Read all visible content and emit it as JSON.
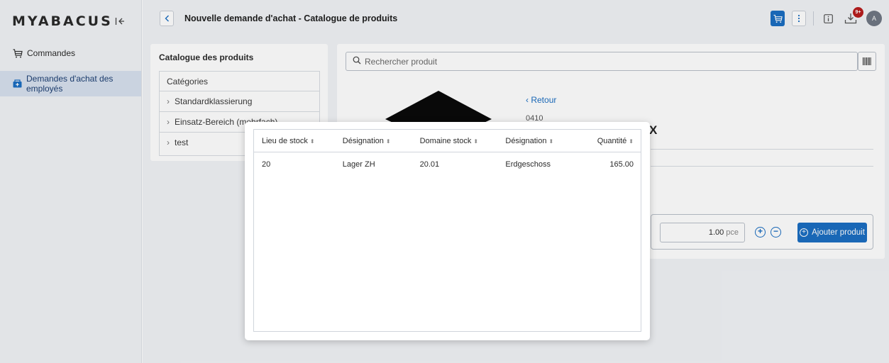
{
  "app": {
    "logo_text": "MYABACUS",
    "accent_color": "#1b6ec2"
  },
  "sidebar": {
    "collapse_icon": "collapse-left-icon",
    "items": [
      {
        "label": "Commandes",
        "icon": "cart-icon",
        "active": false
      },
      {
        "label": "Demandes d'achat des employés",
        "icon": "box-icon",
        "active": true
      }
    ]
  },
  "header": {
    "title": "Nouvelle demande d'achat - Catalogue de produits",
    "badge_count": "9+",
    "avatar_initial": "A"
  },
  "catalogue": {
    "title": "Catalogue des produits",
    "categories_label": "Catégories",
    "items": [
      {
        "label": "Standardklassierung"
      },
      {
        "label": "Einsatz-Bereich (mehrfach)"
      },
      {
        "label": "test"
      }
    ]
  },
  "product": {
    "search_placeholder": "Rechercher produit",
    "back_label": "Retour",
    "number": "0410",
    "name_tail": "X",
    "quantity_value": "1.00",
    "quantity_unit": "pce",
    "add_label": "Ajouter produit"
  },
  "modal": {
    "columns": [
      "Lieu de stock",
      "Désignation",
      "Domaine stock",
      "Désignation",
      "Quantité"
    ],
    "rows": [
      {
        "lieu": "20",
        "designation1": "Lager ZH",
        "domaine": "20.01",
        "designation2": "Erdgeschoss",
        "quantite": "165.00"
      }
    ]
  }
}
